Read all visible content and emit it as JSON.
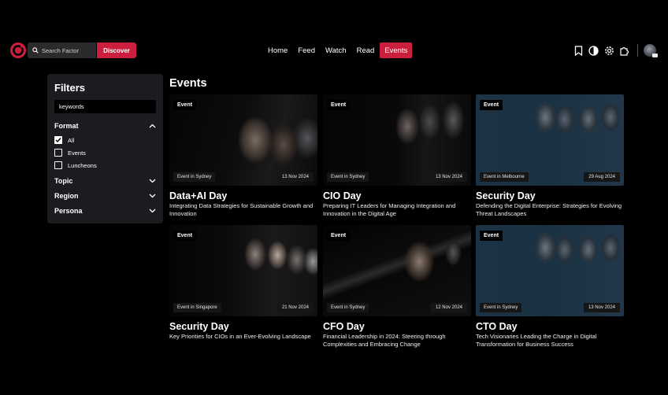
{
  "header": {
    "search_placeholder": "Search Factor",
    "discover_label": "Discover",
    "nav": [
      "Home",
      "Feed",
      "Watch",
      "Read",
      "Events"
    ],
    "active_nav": "Events",
    "accent_color": "#cc1f3e"
  },
  "filters": {
    "title": "Filters",
    "keywords_placeholder": "keywords",
    "format": {
      "label": "Format",
      "options": [
        {
          "label": "All",
          "checked": true
        },
        {
          "label": "Events",
          "checked": false
        },
        {
          "label": "Luncheons",
          "checked": false
        }
      ]
    },
    "topic_label": "Topic",
    "region_label": "Region",
    "persona_label": "Persona"
  },
  "events": {
    "title": "Events",
    "cards": [
      {
        "badge": "Event",
        "location": "Event in Sydney",
        "date": "13 Nov 2024",
        "title": "Data+AI Day",
        "desc": "Integrating Data Strategies for Sustainable Growth and Innovation"
      },
      {
        "badge": "Event",
        "location": "Event in Sydney",
        "date": "13 Nov 2024",
        "title": "CIO Day",
        "desc": "Preparing IT Leaders for Managing Integration and Innovation in the Digital Age"
      },
      {
        "badge": "Event",
        "location": "Event in Melbourne",
        "date": "29 Aug 2024",
        "title": "Security Day",
        "desc": "Defending the Digital Enterprise: Strategies for Evolving Threat Landscapes"
      },
      {
        "badge": "Event",
        "location": "Event in Singapore",
        "date": "21 Nov 2024",
        "title": "Security Day",
        "desc": "Key Priorities for CIOs in an Ever-Evolving Landscape"
      },
      {
        "badge": "Event",
        "location": "Event in Sydney",
        "date": "12 Nov 2024",
        "title": "CFO Day",
        "desc": "Financial Leadership in 2024: Steering through Complexities and Embracing Change"
      },
      {
        "badge": "Event",
        "location": "Event in Sydney",
        "date": "13 Nov 2024",
        "title": "CTO Day",
        "desc": "Tech Visionaries Leading the Charge in Digital Transformation for Business Success"
      }
    ]
  }
}
